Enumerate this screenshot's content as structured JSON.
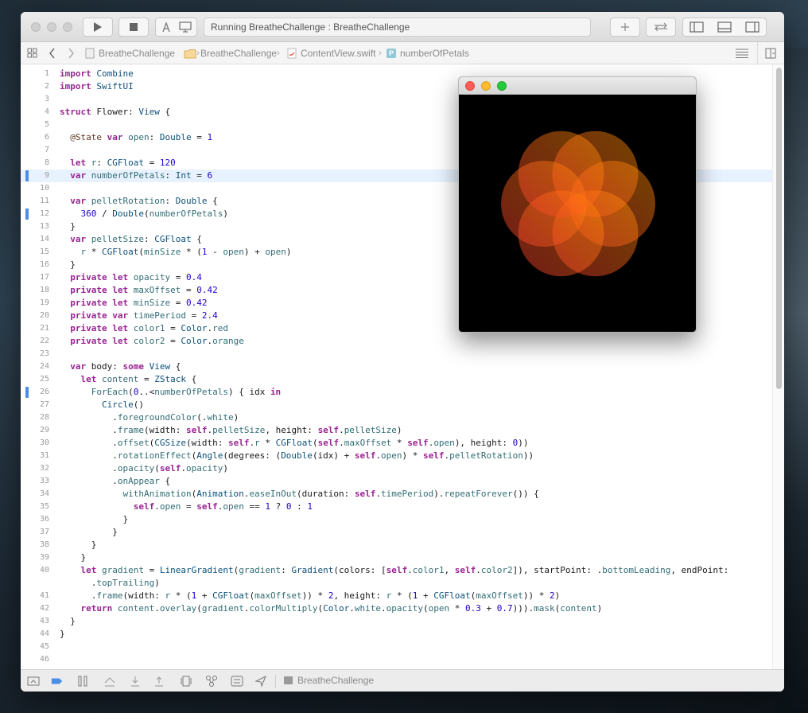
{
  "toolbar": {
    "status_text": "Running BreatheChallenge : BreatheChallenge"
  },
  "jumpbar": {
    "items": [
      "BreatheChallenge",
      "BreatheChallenge",
      "ContentView.swift",
      "numberOfPetals"
    ]
  },
  "bottom_bar": {
    "scheme_label": "BreatheChallenge"
  },
  "editor": {
    "line_numbers": [
      "1",
      "2",
      "3",
      "4",
      "5",
      "6",
      "7",
      "8",
      "9",
      "10",
      "11",
      "12",
      "13",
      "14",
      "15",
      "16",
      "17",
      "18",
      "19",
      "20",
      "21",
      "22",
      "23",
      "24",
      "25",
      "26",
      "27",
      "28",
      "29",
      "30",
      "31",
      "32",
      "33",
      "34",
      "35",
      "36",
      "37",
      "38",
      "39",
      "40",
      "",
      "41",
      "42",
      "43",
      "44",
      "45",
      "46"
    ],
    "code_lines": [
      "import Combine",
      "import SwiftUI",
      "",
      "struct Flower: View {",
      "",
      "  @State var open: Double = 1",
      "",
      "  let r: CGFloat = 120",
      "  var numberOfPetals: Int = 6",
      "",
      "  var pelletRotation: Double {",
      "    360 / Double(numberOfPetals)",
      "  }",
      "  var pelletSize: CGFloat {",
      "    r * CGFloat(minSize * (1 - open) + open)",
      "  }",
      "  private let opacity = 0.4",
      "  private let maxOffset = 0.42",
      "  private let minSize = 0.42",
      "  private var timePeriod = 2.4",
      "  private let color1 = Color.red",
      "  private let color2 = Color.orange",
      "",
      "  var body: some View {",
      "    let content = ZStack {",
      "      ForEach(0..<numberOfPetals) { idx in",
      "        Circle()",
      "          .foregroundColor(.white)",
      "          .frame(width: self.pelletSize, height: self.pelletSize)",
      "          .offset(CGSize(width: self.r * CGFloat(self.maxOffset * self.open), height: 0))",
      "          .rotationEffect(Angle(degrees: (Double(idx) + self.open) * self.pelletRotation))",
      "          .opacity(self.opacity)",
      "          .onAppear {",
      "            withAnimation(Animation.easeInOut(duration: self.timePeriod).repeatForever()) {",
      "              self.open = self.open == 1 ? 0 : 1",
      "            }",
      "          }",
      "      }",
      "    }",
      "    let gradient = LinearGradient(gradient: Gradient(colors: [self.color1, self.color2]), startPoint: .bottomLeading, endPoint:",
      "      .topTrailing)",
      "      .frame(width: r * (1 + CGFloat(maxOffset)) * 2, height: r * (1 + CGFloat(maxOffset)) * 2)",
      "    return content.overlay(gradient.colorMultiply(Color.white.opacity(open * 0.3 + 0.7))).mask(content)",
      "  }",
      "}",
      "",
      ""
    ],
    "highlighted_line": 9,
    "breakpoint_lines": [
      9,
      12,
      26
    ]
  },
  "preview": {
    "petal_count": 6,
    "petal_opacity": 0.4,
    "colors": {
      "color1": "#ff3b30",
      "color2": "#ff9500"
    }
  },
  "colors": {
    "accent": "#4a8ee8",
    "keyword": "#9b2393",
    "type": "#0b4f79",
    "number": "#1c00cf"
  }
}
